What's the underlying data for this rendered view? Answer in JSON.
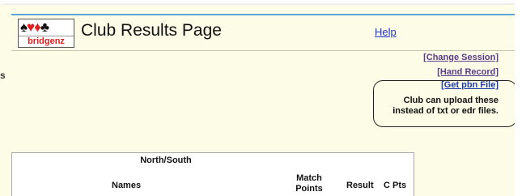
{
  "header": {
    "logo_text": "bridgenz",
    "title": "Club Results Page",
    "help_label": "Help"
  },
  "left_edge_text": "s",
  "links": {
    "change_session": "[Change Session]",
    "hand_record": "[Hand Record]",
    "get_pbn": "[Get pbn File]"
  },
  "callout": {
    "line1": "Club can upload these",
    "line2": "instead of txt or edr files."
  },
  "results": {
    "section_title": "North/South",
    "columns": {
      "names": "Names",
      "match_points_line1": "Match",
      "match_points_line2": "Points",
      "result": "Result",
      "c_pts": "C Pts"
    }
  },
  "colors": {
    "page_bg": "#fdfde7",
    "accent_rule": "#5aa6d8",
    "link_purple": "#5a3a8a",
    "link_blue": "#1a3aa8",
    "logo_red": "#e02020"
  }
}
